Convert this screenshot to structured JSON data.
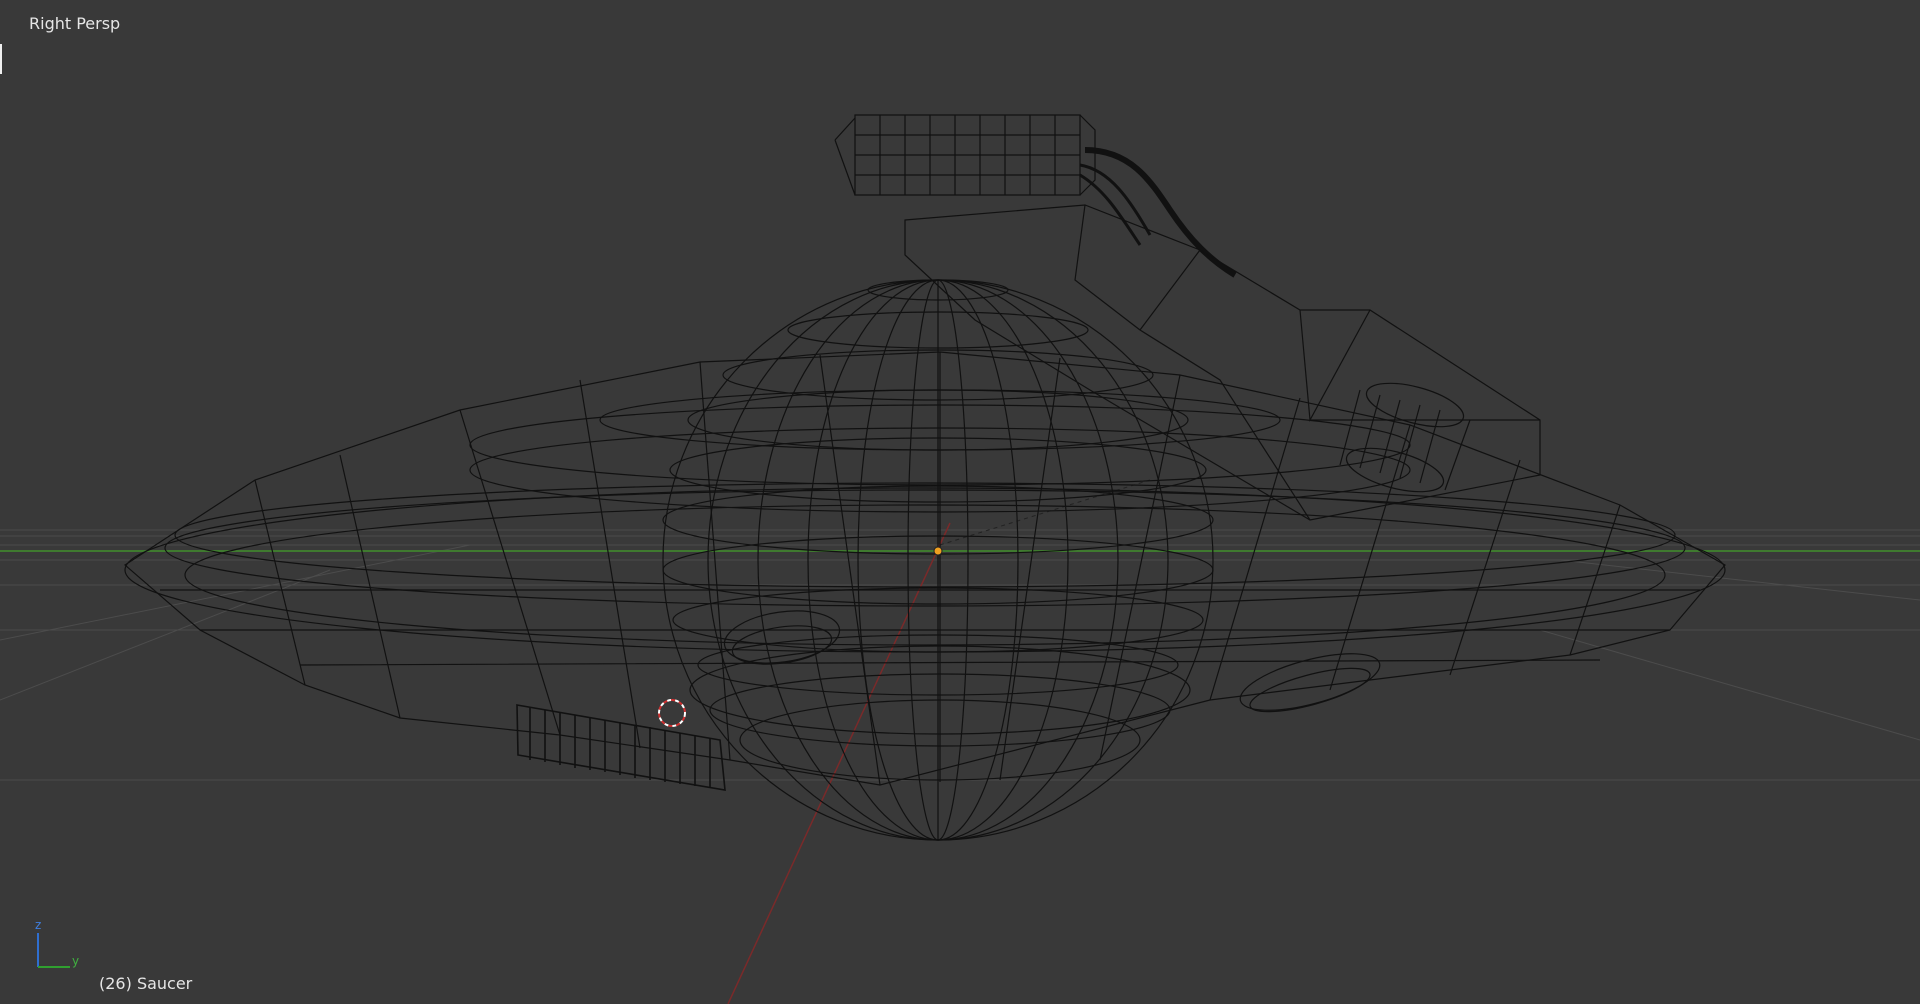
{
  "viewport": {
    "view_name": "Right Persp",
    "frame": "(26)",
    "object_name": "Saucer",
    "axis_labels": {
      "z": "z",
      "y": "y"
    }
  },
  "colors": {
    "background": "#393939",
    "grid": "#4c4c4c",
    "wire": "#111111",
    "y_axis_line": "#3f7a2f",
    "x_axis_line": "#7a2a2a",
    "origin": "#f0a020",
    "cursor": "#ffffff",
    "cursor_alt": "#d03030"
  }
}
